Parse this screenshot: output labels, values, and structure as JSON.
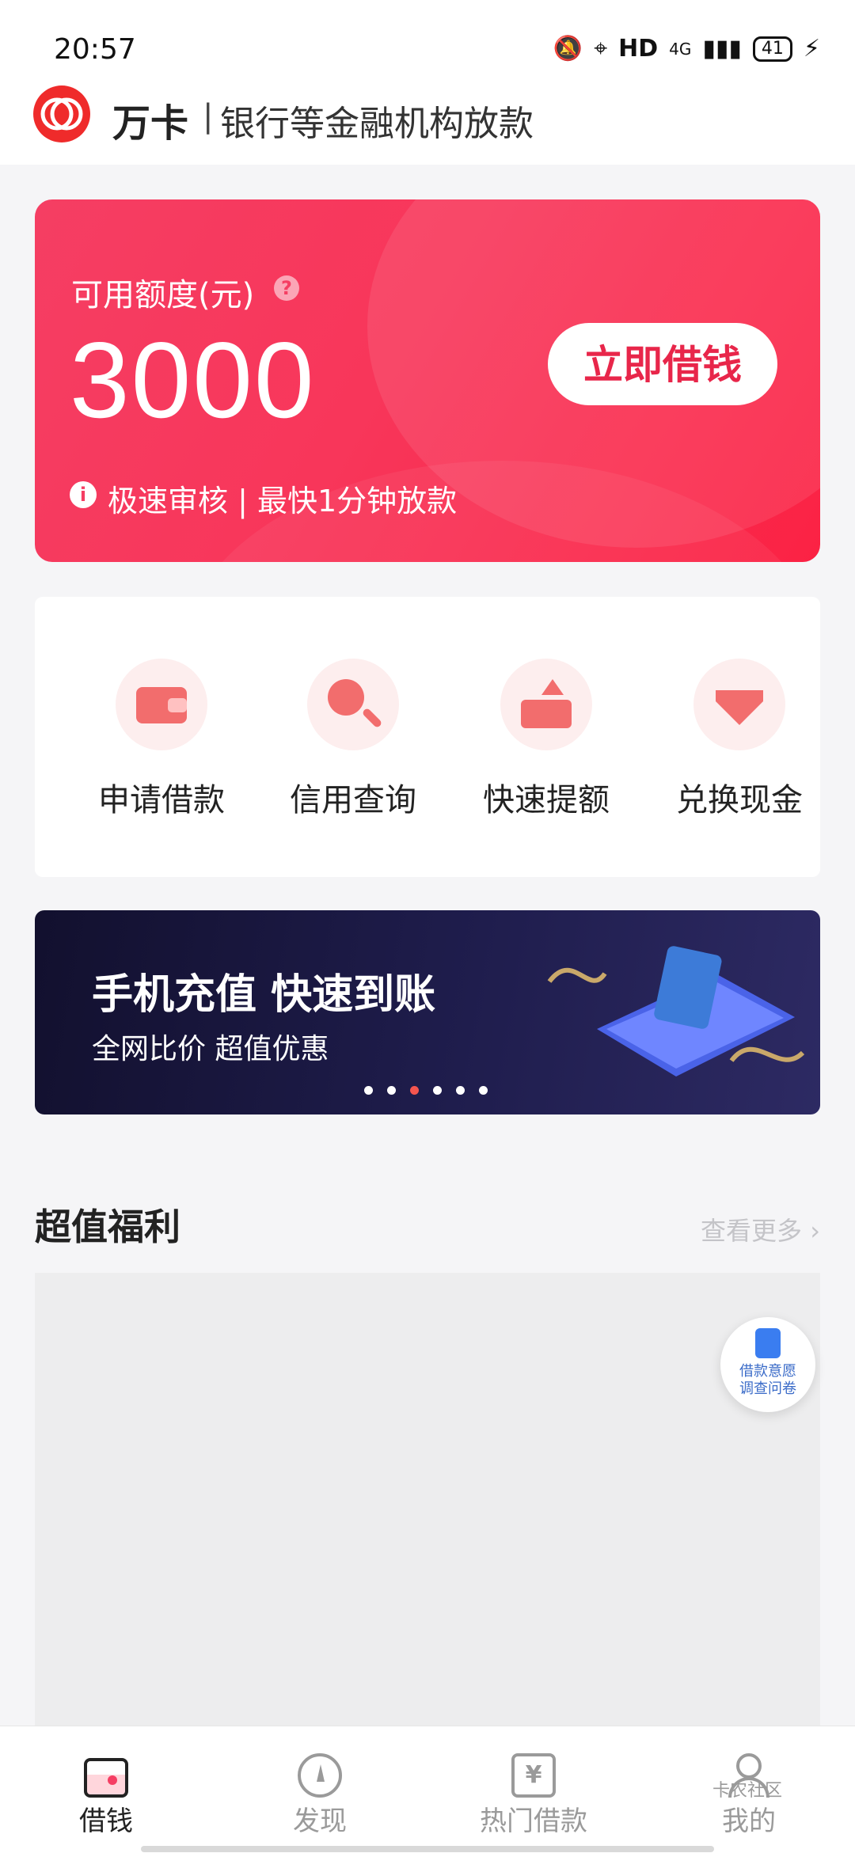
{
  "status_bar": {
    "time": "20:57",
    "network": "HD",
    "signal": "4G",
    "battery": "41"
  },
  "header": {
    "brand": "万卡",
    "separator": "|",
    "subtitle": "银行等金融机构放款"
  },
  "credit_card": {
    "limit_label": "可用额度(元)",
    "help_glyph": "?",
    "limit_value": "3000",
    "borrow_button": "立即借钱",
    "info_glyph": "i",
    "note": "极速审核 | 最快1分钟放款"
  },
  "actions": [
    {
      "label": "申请借款",
      "icon": "wallet-icon"
    },
    {
      "label": "信用查询",
      "icon": "magnifier-icon"
    },
    {
      "label": "快速提额",
      "icon": "raise-limit-icon"
    },
    {
      "label": "兑换现金",
      "icon": "diamond-icon"
    }
  ],
  "banner": {
    "title": "手机充值 快速到账",
    "subtitle": "全网比价 超值优惠",
    "active_dot": 3,
    "dot_count": 6
  },
  "welfare": {
    "title": "超值福利",
    "more": "查看更多 ›"
  },
  "survey": {
    "line1": "借款意愿",
    "line2": "调查问卷"
  },
  "tabbar": [
    {
      "label": "借钱",
      "active": true
    },
    {
      "label": "发现",
      "active": false
    },
    {
      "label": "热门借款",
      "active": false
    },
    {
      "label": "我的",
      "active": false
    }
  ],
  "watermark": "卡农社区",
  "colors": {
    "accent": "#f53e63",
    "brand_red": "#ef2b2b",
    "banner_bg": "#1f1d4d"
  }
}
